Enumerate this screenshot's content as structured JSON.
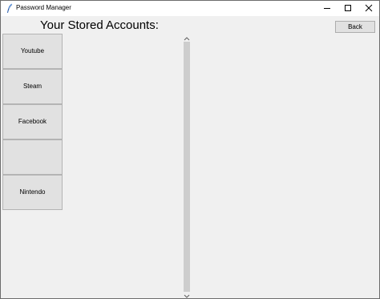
{
  "window": {
    "title": "Password Manager",
    "icon": "feather-icon",
    "controls": [
      "minimize-icon",
      "maximize-icon",
      "close-icon"
    ]
  },
  "header": {
    "title": "Your Stored Accounts:",
    "back_label": "Back"
  },
  "accounts": [
    {
      "label": "Youtube"
    },
    {
      "label": "Steam"
    },
    {
      "label": "Facebook"
    },
    {
      "label": ""
    },
    {
      "label": "Nintendo"
    }
  ],
  "scrollbar": {
    "up_icon": "chevron-up-icon",
    "down_icon": "chevron-down-icon"
  }
}
